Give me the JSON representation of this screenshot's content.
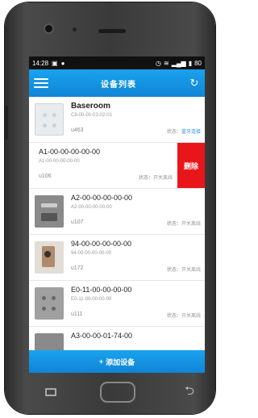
{
  "statusbar": {
    "time": "14:28",
    "battery": "80"
  },
  "navbar": {
    "title": "设备列表"
  },
  "devices": [
    {
      "name": "Baseroom",
      "mac": "C9-00-00-03-02-01",
      "uid": "u463",
      "status_label": "状态：",
      "status_value": "蓝牙连接"
    },
    {
      "name": "A1-00-00-00-00-00",
      "mac": "A1-00-00-00-00-00",
      "uid": "u106",
      "status_label": "状态：",
      "status_value": "开关离线"
    },
    {
      "name": "A2-00-00-00-00-00",
      "mac": "A2-00-00-00-00-00",
      "uid": "u107",
      "status_label": "状态：",
      "status_value": "开关离线"
    },
    {
      "name": "94-00-00-00-00-00",
      "mac": "94-00-00-00-00-00",
      "uid": "u172",
      "status_label": "状态：",
      "status_value": "开关离线"
    },
    {
      "name": "E0-11-00-00-00-00",
      "mac": "E0-11-00-00-00-00",
      "uid": "u111",
      "status_label": "状态：",
      "status_value": "开关离线"
    },
    {
      "name": "A3-00-00-01-74-00",
      "mac": "",
      "uid": "",
      "status_label": "",
      "status_value": ""
    }
  ],
  "swipe_action": {
    "delete_label": "删除"
  },
  "add_bar": {
    "label": "添加设备"
  },
  "colors": {
    "accent": "#1592e0",
    "delete": "#e8161b",
    "status_online": "#2a8fd6"
  }
}
